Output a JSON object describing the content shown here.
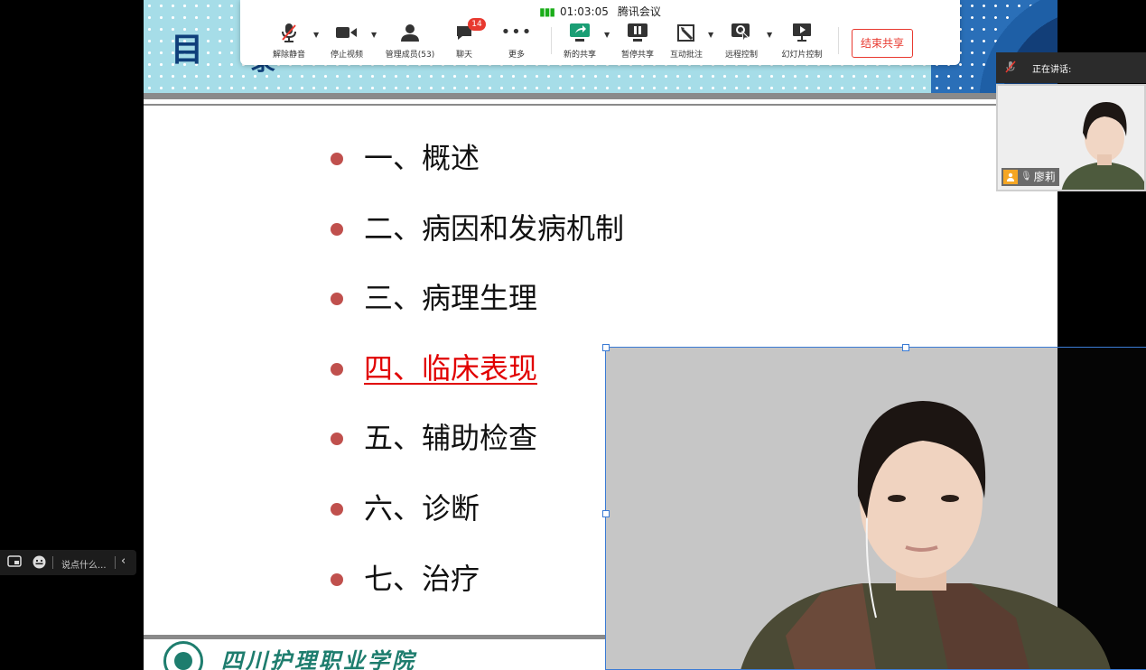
{
  "slide": {
    "heading_char": "目",
    "heading_char2": "录",
    "toc": [
      {
        "label": "一、概述",
        "active": false
      },
      {
        "label": "二、病因和发病机制",
        "active": false
      },
      {
        "label": "三、病理生理",
        "active": false
      },
      {
        "label": "四、临床表现",
        "active": true
      },
      {
        "label": "五、辅助检查",
        "active": false
      },
      {
        "label": "六、诊断",
        "active": false
      },
      {
        "label": "七、治疗",
        "active": false
      }
    ],
    "footer_name": "四川护理职业学院",
    "bullet_color": "#c0504d",
    "active_color": "#e10000"
  },
  "toolbar": {
    "duration": "01:03:05",
    "app_name": "腾讯会议",
    "buttons": {
      "mute": "解除静音",
      "video": "停止视频",
      "members": "管理成员(53)",
      "chat": "聊天",
      "chat_badge": "14",
      "more": "更多",
      "new_share": "新的共享",
      "pause_share": "暂停共享",
      "annotate": "互动批注",
      "remote": "远程控制",
      "slides": "幻灯片控制"
    },
    "end_share": "结束共享"
  },
  "speaking": {
    "label": "正在讲话:",
    "participant_name": "廖莉"
  },
  "chat_input": {
    "placeholder": "说点什么..."
  }
}
